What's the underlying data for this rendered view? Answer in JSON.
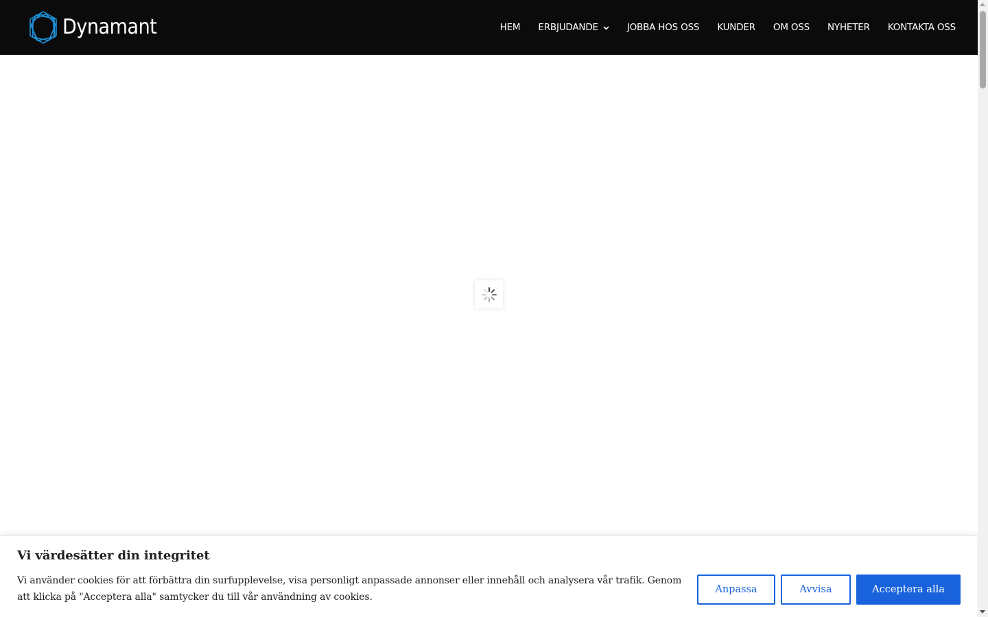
{
  "header": {
    "logo_text": "Dynamant",
    "nav": [
      {
        "label": "HEM"
      },
      {
        "label": "ERBJUDANDE"
      },
      {
        "label": "JOBBA HOS OSS"
      },
      {
        "label": "KUNDER"
      },
      {
        "label": "OM OSS"
      },
      {
        "label": "NYHETER"
      },
      {
        "label": "KONTAKTA OSS"
      }
    ]
  },
  "cookie_banner": {
    "title": "Vi värdesätter din integritet",
    "text": "Vi använder cookies för att förbättra din surfupplevelse, visa personligt anpassade annonser eller innehåll och analysera vår trafik. Genom att klicka på \"Acceptera alla\" samtycker du till vår användning av cookies.",
    "customize_label": "Anpassa",
    "reject_label": "Avvisa",
    "accept_label": "Acceptera alla"
  },
  "colors": {
    "header_bg": "#0b0b0b",
    "logo_accent": "#1e8fd6",
    "button_primary": "#1863dc"
  },
  "icons": {
    "logo": "dynamant-logo-mark-icon",
    "dropdown": "chevron-down-icon",
    "loader": "spinner-icon"
  }
}
